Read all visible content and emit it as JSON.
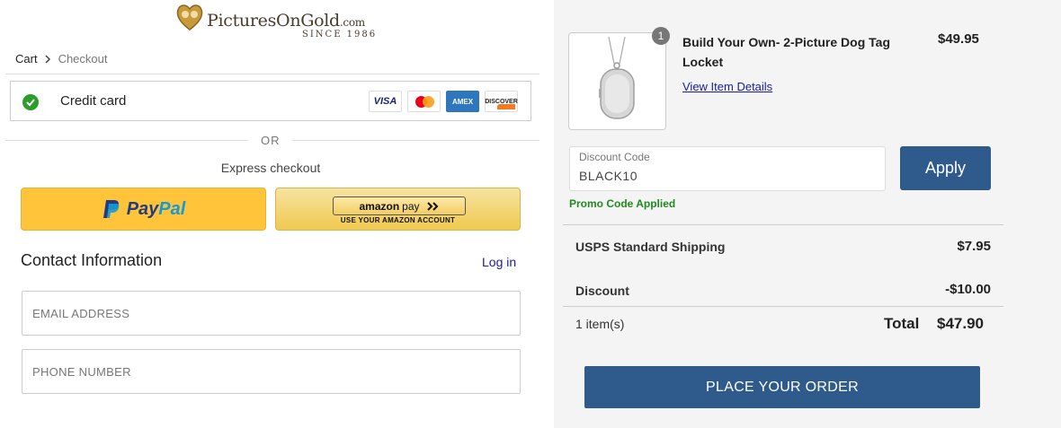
{
  "brand": {
    "name": "PicturesOnGold",
    "suffix": ".com",
    "tagline": "SINCE 1986"
  },
  "breadcrumb": {
    "cart": "Cart",
    "checkout": "Checkout"
  },
  "payment": {
    "selected_label": "Credit card",
    "cards": [
      "VISA",
      "Mastercard",
      "AMEX",
      "DISCOVER"
    ]
  },
  "divider_text": "OR",
  "express": {
    "title": "Express checkout",
    "paypal_a": "Pay",
    "paypal_b": "Pal",
    "amazon_main_a": "amazon",
    "amazon_main_b": "pay",
    "amazon_sub": "USE YOUR AMAZON ACCOUNT"
  },
  "contact": {
    "title": "Contact Information",
    "login": "Log in",
    "email_placeholder": "EMAIL ADDRESS",
    "phone_placeholder": "PHONE NUMBER"
  },
  "order": {
    "item": {
      "quantity": "1",
      "name": "Build Your Own- 2-Picture Dog Tag Locket",
      "details_link": "View Item Details",
      "price": "$49.95"
    },
    "discount": {
      "label": "Discount Code",
      "value": "BLACK10",
      "apply": "Apply",
      "message": "Promo Code Applied"
    },
    "shipping_label": "USPS Standard Shipping",
    "shipping_value": "$7.95",
    "discount_label": "Discount",
    "discount_value": "-$10.00",
    "items_count": "1 item(s)",
    "total_label": "Total",
    "total_value": "$47.90",
    "place_order": "PLACE YOUR ORDER"
  },
  "colors": {
    "primary_button": "#2f5b8c",
    "success": "#1f8a1f",
    "paypal_yellow": "#ffc439",
    "link": "#1a1aa6"
  }
}
